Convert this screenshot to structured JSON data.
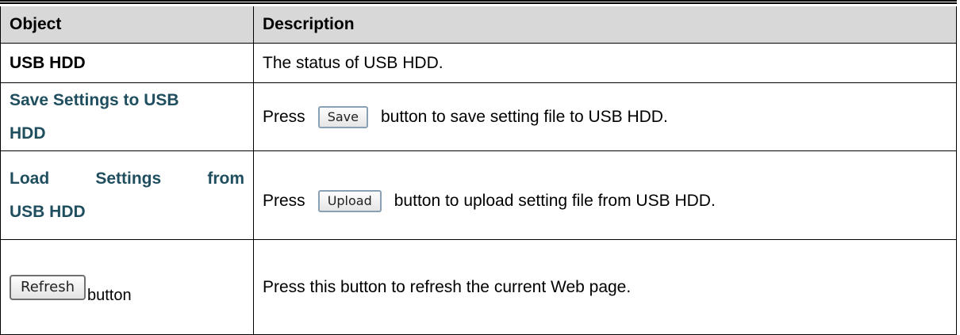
{
  "table": {
    "header": {
      "object": "Object",
      "description": "Description"
    },
    "rows": [
      {
        "object": "USB HDD",
        "description": "The status of USB HDD."
      },
      {
        "object_line1": "Save Settings to USB",
        "object_line2": "HDD",
        "desc_prefix": "Press",
        "button_label": "Save",
        "desc_suffix": "button to save setting file to USB HDD."
      },
      {
        "object_word1": "Load",
        "object_word2": "Settings",
        "object_word3": "from",
        "object_line2": "USB HDD",
        "desc_prefix": "Press",
        "button_label": "Upload",
        "desc_suffix": "button to upload setting file from USB HDD."
      },
      {
        "button_label": "Refresh",
        "object_suffix": "button",
        "description": "Press this button to refresh the current Web page."
      }
    ]
  }
}
